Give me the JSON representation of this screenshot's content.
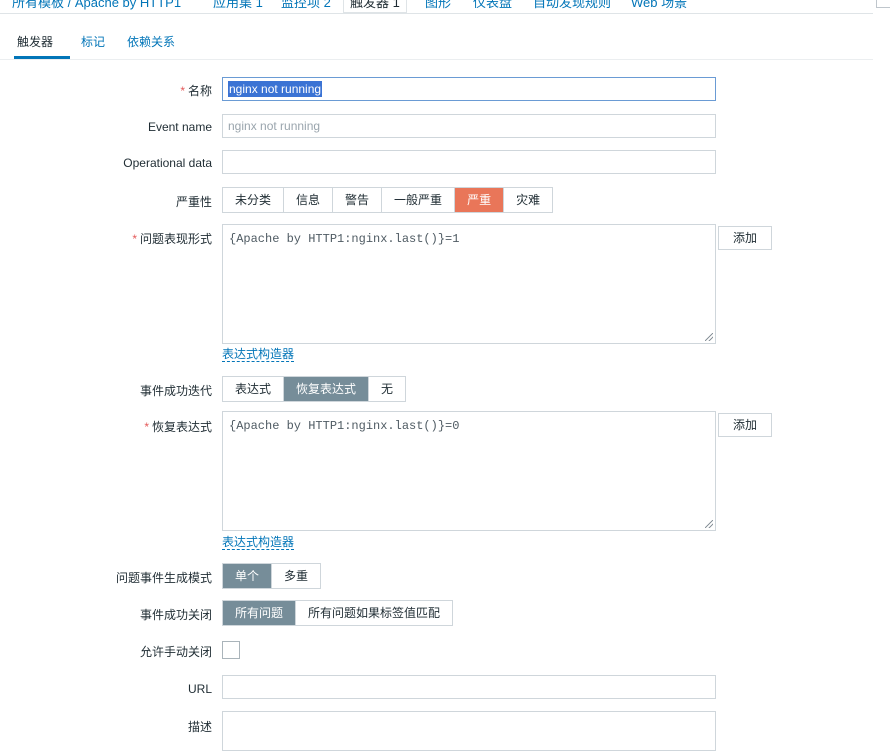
{
  "breadcrumb": [
    "所有模板 / Apache by HTTP1",
    "应用集 1",
    "监控项 2",
    "触发器 1",
    "图形",
    "仪表盘",
    "自动发现规则",
    "Web 场景"
  ],
  "tabs": [
    "触发器",
    "标记",
    "依赖关系"
  ],
  "form": {
    "name": {
      "label": "名称",
      "value": "nginx not running"
    },
    "event_name": {
      "label": "Event name",
      "placeholder": "nginx not running"
    },
    "operational_data": {
      "label": "Operational data",
      "value": ""
    },
    "severity": {
      "label": "严重性",
      "options": [
        "未分类",
        "信息",
        "警告",
        "一般严重",
        "严重",
        "灾难"
      ],
      "selected": "严重"
    },
    "expression": {
      "label": "问题表现形式",
      "value": "{Apache by HTTP1:nginx.last()}=1",
      "add_label": "添加",
      "builder_link": "表达式构造器"
    },
    "ok_event_generation": {
      "label": "事件成功迭代",
      "options": [
        "表达式",
        "恢复表达式",
        "无"
      ],
      "selected": "恢复表达式"
    },
    "recovery_expression": {
      "label": "恢复表达式",
      "value": "{Apache by HTTP1:nginx.last()}=0",
      "add_label": "添加",
      "builder_link": "表达式构造器"
    },
    "problem_event_mode": {
      "label": "问题事件生成模式",
      "options": [
        "单个",
        "多重"
      ],
      "selected": "单个"
    },
    "ok_event_closes": {
      "label": "事件成功关闭",
      "options": [
        "所有问题",
        "所有问题如果标签值匹配"
      ],
      "selected": "所有问题"
    },
    "manual_close": {
      "label": "允许手动关闭",
      "checked": false
    },
    "url": {
      "label": "URL",
      "value": ""
    },
    "description": {
      "label": "描述",
      "value": ""
    }
  },
  "colors": {
    "accent": "#0275b8",
    "severity_high": "#e97659",
    "selected_segment": "#768d99",
    "required": "#e45959"
  }
}
